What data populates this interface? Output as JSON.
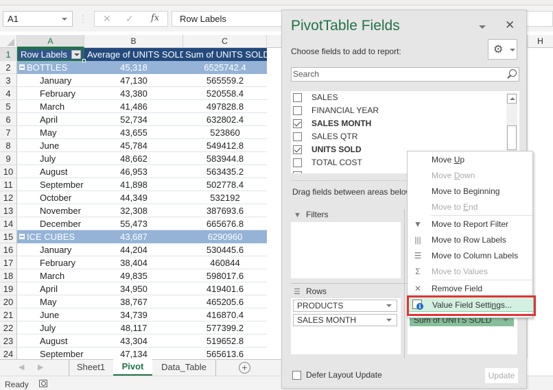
{
  "formula_bar": {
    "name_box": "A1",
    "cancel_icon": "✕",
    "enter_icon": "✓",
    "fx_label": "fx",
    "formula": "Row Labels"
  },
  "columns": {
    "a": "A",
    "b": "B",
    "c": "C",
    "h": "H"
  },
  "pivot_header": {
    "row_labels": "Row Labels",
    "average": "Average of UNITS SOLD",
    "sum": "Sum of UNITS SOLD"
  },
  "rows": [
    {
      "n": "2",
      "type": "group",
      "label": "BOTTLES",
      "avg": "45,318",
      "sum": "6525742.4"
    },
    {
      "n": "3",
      "type": "item",
      "label": "January",
      "avg": "47,130",
      "sum": "565559.2"
    },
    {
      "n": "4",
      "type": "item",
      "label": "February",
      "avg": "43,380",
      "sum": "520558.4"
    },
    {
      "n": "5",
      "type": "item",
      "label": "March",
      "avg": "41,486",
      "sum": "497828.8"
    },
    {
      "n": "6",
      "type": "item",
      "label": "April",
      "avg": "52,734",
      "sum": "632802.4"
    },
    {
      "n": "7",
      "type": "item",
      "label": "May",
      "avg": "43,655",
      "sum": "523860"
    },
    {
      "n": "8",
      "type": "item",
      "label": "June",
      "avg": "45,784",
      "sum": "549412.8"
    },
    {
      "n": "9",
      "type": "item",
      "label": "July",
      "avg": "48,662",
      "sum": "583944.8"
    },
    {
      "n": "10",
      "type": "item",
      "label": "August",
      "avg": "46,953",
      "sum": "563435.2"
    },
    {
      "n": "11",
      "type": "item",
      "label": "September",
      "avg": "41,898",
      "sum": "502778.4"
    },
    {
      "n": "12",
      "type": "item",
      "label": "October",
      "avg": "44,349",
      "sum": "532192"
    },
    {
      "n": "13",
      "type": "item",
      "label": "November",
      "avg": "32,308",
      "sum": "387693.6"
    },
    {
      "n": "14",
      "type": "item",
      "label": "December",
      "avg": "55,473",
      "sum": "665676.8"
    },
    {
      "n": "15",
      "type": "group",
      "label": "ICE CUBES",
      "avg": "43,687",
      "sum": "6290960"
    },
    {
      "n": "16",
      "type": "item",
      "label": "January",
      "avg": "44,204",
      "sum": "530445.6"
    },
    {
      "n": "17",
      "type": "item",
      "label": "February",
      "avg": "38,404",
      "sum": "460844"
    },
    {
      "n": "18",
      "type": "item",
      "label": "March",
      "avg": "49,835",
      "sum": "598017.6"
    },
    {
      "n": "19",
      "type": "item",
      "label": "April",
      "avg": "34,950",
      "sum": "419401.6"
    },
    {
      "n": "20",
      "type": "item",
      "label": "May",
      "avg": "38,767",
      "sum": "465205.6"
    },
    {
      "n": "21",
      "type": "item",
      "label": "June",
      "avg": "34,739",
      "sum": "416870.4"
    },
    {
      "n": "22",
      "type": "item",
      "label": "July",
      "avg": "48,117",
      "sum": "577399.2"
    },
    {
      "n": "23",
      "type": "item",
      "label": "August",
      "avg": "43,304",
      "sum": "519652.8"
    },
    {
      "n": "24",
      "type": "item",
      "label": "September",
      "avg": "47,134",
      "sum": "565613.6"
    }
  ],
  "sheet_tabs": [
    "Sheet1",
    "Pivot",
    "Data_Table"
  ],
  "active_sheet": "Pivot",
  "add_sheet": "+",
  "status": {
    "text": "Ready"
  },
  "pane": {
    "title": "PivotTable Fields",
    "subtitle": "Choose fields to add to report:",
    "gear_icon": "⚙",
    "search_placeholder": "Search",
    "fields": [
      {
        "label": "SALES",
        "checked": false
      },
      {
        "label": "FINANCIAL YEAR",
        "checked": false
      },
      {
        "label": "SALES MONTH",
        "checked": true
      },
      {
        "label": "SALES QTR",
        "checked": false
      },
      {
        "label": "UNITS SOLD",
        "checked": true
      },
      {
        "label": "TOTAL COST",
        "checked": false
      }
    ],
    "drag_text": "Drag fields between areas below:",
    "filters_label": "Filters",
    "rows_label": "Rows",
    "rows_fields": [
      "PRODUCTS",
      "SALES MONTH"
    ],
    "values_fields": [
      "Sum of UNITS SOLD"
    ],
    "defer_label": "Defer Layout Update",
    "update_label": "Update"
  },
  "context_menu": {
    "items": [
      {
        "pre": "Move ",
        "u": "U",
        "post": "p",
        "disabled": false
      },
      {
        "pre": "Move ",
        "u": "D",
        "post": "own",
        "disabled": true
      },
      {
        "pre": "Move to Be",
        "u": "g",
        "post": "inning",
        "disabled": false
      },
      {
        "pre": "Move to ",
        "u": "E",
        "post": "nd",
        "disabled": true
      },
      {
        "pre": "Move to Report Filter",
        "u": "",
        "post": "",
        "disabled": false
      },
      {
        "pre": "Move to Row Labels",
        "u": "",
        "post": "",
        "disabled": false
      },
      {
        "pre": "Move to Column Labels",
        "u": "",
        "post": "",
        "disabled": false
      },
      {
        "pre": "Move to Values",
        "u": "",
        "post": "",
        "disabled": true
      },
      {
        "pre": "Remove Field",
        "u": "",
        "post": "",
        "disabled": false
      },
      {
        "pre": "Value Field Setti",
        "u": "n",
        "post": "gs...",
        "disabled": false
      }
    ]
  },
  "colors": {
    "accent_green": "#217346",
    "pivot_header": "#244a7c",
    "group_row": "#95b3d7",
    "values_chip": "#86bf9a",
    "highlight_border": "#e03434"
  }
}
